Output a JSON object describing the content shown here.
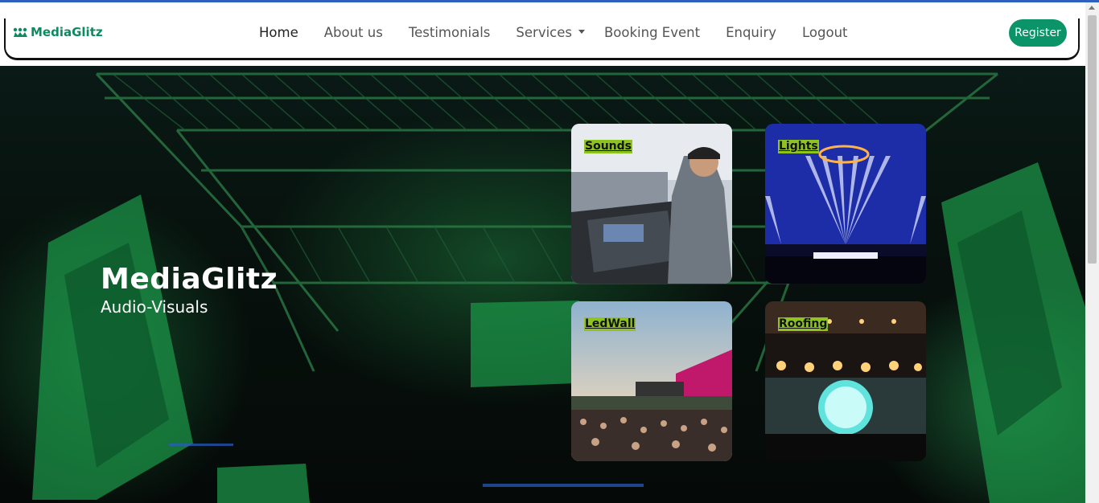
{
  "brand": {
    "name": "MediaGlitz",
    "icon": "brand-logo-icon",
    "color": "#0e8a5f"
  },
  "nav": {
    "links": [
      {
        "label": "Home",
        "active": true
      },
      {
        "label": "About us"
      },
      {
        "label": "Testimonials"
      },
      {
        "label": "Services",
        "dropdown": true
      },
      {
        "label": "Booking Event"
      },
      {
        "label": "Enquiry"
      },
      {
        "label": "Logout"
      }
    ],
    "register_label": "Register",
    "register_color": "#0b9467"
  },
  "hero": {
    "title": "MediaGlitz",
    "subtitle": "Audio-Visuals"
  },
  "cards": [
    {
      "label": "Sounds"
    },
    {
      "label": "Lights"
    },
    {
      "label": "LedWall"
    },
    {
      "label": "Roofing"
    }
  ],
  "colors": {
    "card_label_bg": "#8fc31f",
    "accent_green": "#2db84d"
  }
}
